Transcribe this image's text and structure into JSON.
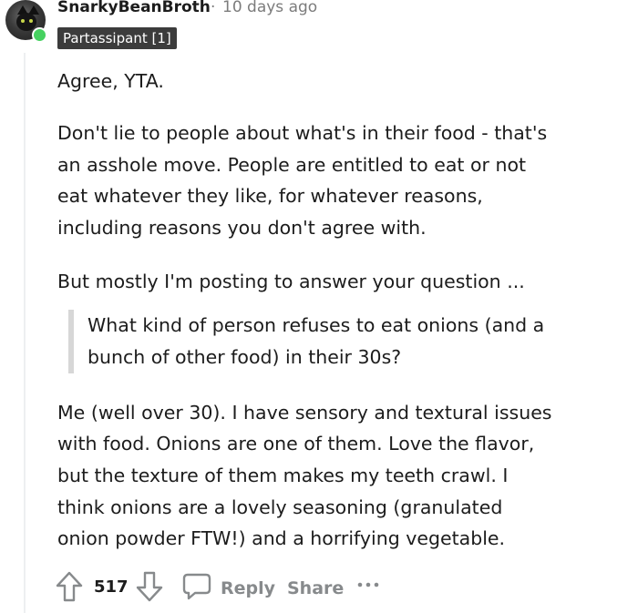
{
  "comment": {
    "username": "SnarkyBeanBroth",
    "separator": "·",
    "timestamp": "10 days ago",
    "flair": "Partassipant [1]",
    "paragraphs": [
      [
        "Agree, YTA."
      ],
      [
        "Don't lie to people about what's in their food - that's",
        "an asshole move. People are entitled to eat or not",
        "eat whatever they like, for whatever reasons,",
        "including reasons you don't agree with."
      ],
      [
        "But mostly I'm posting to answer your question ..."
      ]
    ],
    "quote": [
      "What kind of person refuses to eat onions (and a",
      "bunch of other food) in their 30s?"
    ],
    "final_paragraph": [
      "Me (well over 30). I have sensory and textural issues",
      "with food. Onions are one of them. Love the flavor,",
      "but the texture of them makes my teeth crawl. I",
      "think onions are a lovely seasoning (granulated",
      "onion powder FTW!) and a horrifying vegetable."
    ]
  },
  "actions": {
    "score": "517",
    "reply_label": "Reply",
    "share_label": "Share",
    "icons": [
      "upvote-icon",
      "downvote-icon",
      "comment-icon",
      "more-options-icon"
    ]
  },
  "colors": {
    "flair_bg": "#3c3c3c",
    "online": "#46d160",
    "muted": "#878a8c",
    "quote_bar": "#d7d7d7"
  }
}
